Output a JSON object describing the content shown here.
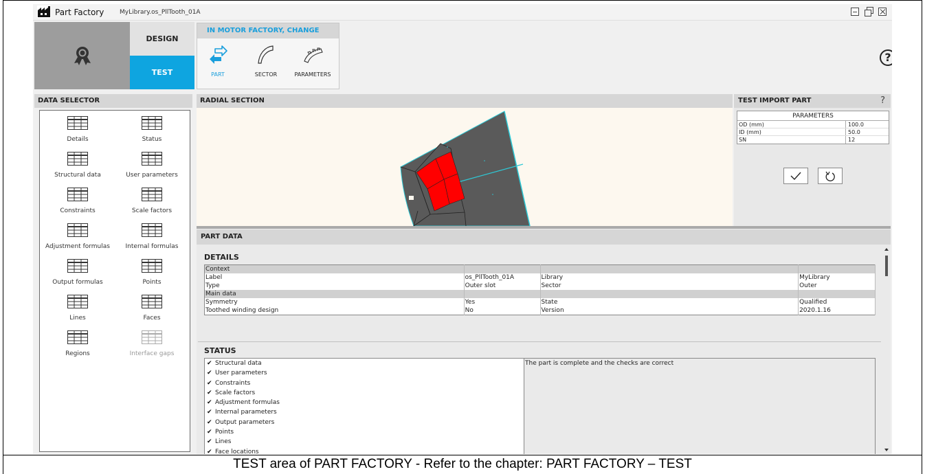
{
  "window": {
    "app_title": "Part Factory",
    "file_title": "MyLibrary.os_PllTooth_01A"
  },
  "mode": {
    "design_label": "DESIGN",
    "test_label": "TEST",
    "active": "TEST"
  },
  "motor_factory": {
    "header": "IN MOTOR FACTORY, CHANGE",
    "items": [
      {
        "label": "PART",
        "icon": "swap-arrows-icon",
        "active": true
      },
      {
        "label": "SECTOR",
        "icon": "sector-icon",
        "active": false
      },
      {
        "label": "PARAMETERS",
        "icon": "gear-sector-icon",
        "active": false
      }
    ]
  },
  "help": {
    "label": "?"
  },
  "data_selector": {
    "header": "DATA SELECTOR",
    "items": [
      {
        "label": "Details",
        "enabled": true
      },
      {
        "label": "Status",
        "enabled": true
      },
      {
        "label": "Structural data",
        "enabled": true
      },
      {
        "label": "User parameters",
        "enabled": true
      },
      {
        "label": "Constraints",
        "enabled": true
      },
      {
        "label": "Scale factors",
        "enabled": true
      },
      {
        "label": "Adjustment formulas",
        "enabled": true
      },
      {
        "label": "Internal formulas",
        "enabled": true
      },
      {
        "label": "Output formulas",
        "enabled": true
      },
      {
        "label": "Points",
        "enabled": true
      },
      {
        "label": "Lines",
        "enabled": true
      },
      {
        "label": "Faces",
        "enabled": true
      },
      {
        "label": "Regions",
        "enabled": true
      },
      {
        "label": "Interface gaps",
        "enabled": false
      }
    ]
  },
  "radial_section": {
    "header": "RADIAL SECTION",
    "colors": {
      "stator": "#5a5a5a",
      "winding": "#ff0000",
      "outline": "#2ec9d6",
      "background": "#fdf8ef"
    }
  },
  "test_import": {
    "header": "TEST IMPORT PART",
    "help": "?",
    "params_header": "PARAMETERS",
    "params": [
      {
        "key": "OD (mm)",
        "value": "100.0"
      },
      {
        "key": "ID (mm)",
        "value": "50.0"
      },
      {
        "key": "SN",
        "value": "12"
      }
    ],
    "apply_icon": "check-icon",
    "reset_icon": "undo-icon"
  },
  "part_data": {
    "header": "PART DATA",
    "details_title": "DETAILS",
    "details_rows": [
      {
        "group": true,
        "cells": [
          "Context",
          "",
          "",
          ""
        ]
      },
      {
        "group": false,
        "cells": [
          "Label",
          "os_PllTooth_01A",
          "Library",
          "MyLibrary"
        ]
      },
      {
        "group": false,
        "cells": [
          "Type",
          "Outer slot",
          "Sector",
          "Outer"
        ]
      },
      {
        "group": true,
        "cells": [
          "Main data",
          "",
          "",
          ""
        ]
      },
      {
        "group": false,
        "cells": [
          "Symmetry",
          "Yes",
          "State",
          "Qualified"
        ]
      },
      {
        "group": false,
        "cells": [
          "Toothed winding design",
          "No",
          "Version",
          "2020.1.16"
        ]
      }
    ],
    "status_title": "STATUS",
    "status_items": [
      "Structural data",
      "User parameters",
      "Constraints",
      "Scale factors",
      "Adjustment formulas",
      "Internal parameters",
      "Output parameters",
      "Points",
      "Lines",
      "Face locations"
    ],
    "status_message": "The part is complete and the checks are correct"
  },
  "caption": "TEST area of PART FACTORY - Refer to the chapter: PART FACTORY – TEST"
}
